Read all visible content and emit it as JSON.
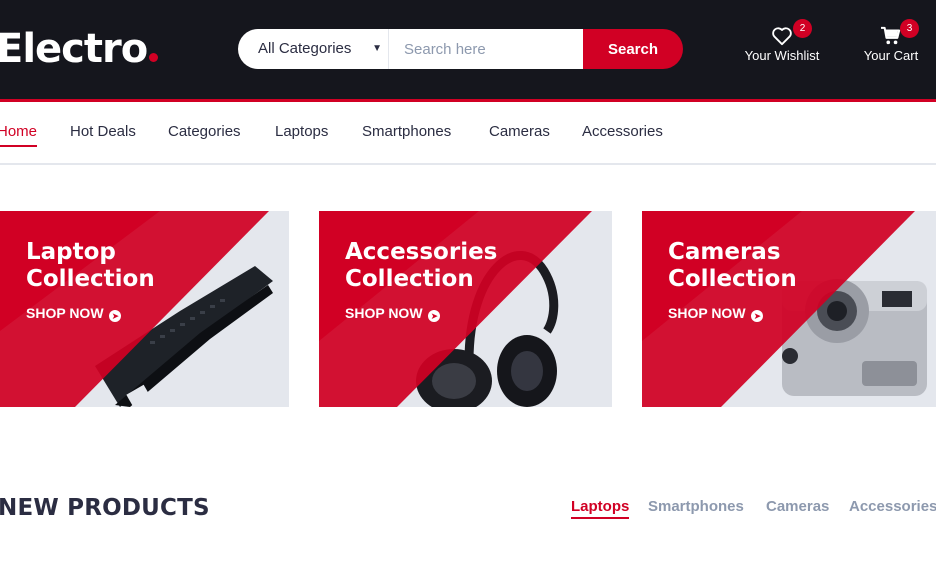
{
  "header": {
    "logo_text": "Electro",
    "search": {
      "category_selected": "All Categories",
      "placeholder": "Search here",
      "value": "",
      "button_label": "Search"
    },
    "wishlist": {
      "label": "Your Wishlist",
      "count": "2",
      "icon": "heart-icon"
    },
    "cart": {
      "label": "Your Cart",
      "count": "3",
      "icon": "cart-icon"
    }
  },
  "nav": {
    "items": [
      {
        "label": "Home",
        "active": true
      },
      {
        "label": "Hot Deals"
      },
      {
        "label": "Categories"
      },
      {
        "label": "Laptops"
      },
      {
        "label": "Smartphones"
      },
      {
        "label": "Cameras"
      },
      {
        "label": "Accessories"
      }
    ]
  },
  "collections": [
    {
      "title_line1": "Laptop",
      "title_line2": "Collection",
      "cta": "SHOP NOW",
      "image": "laptop"
    },
    {
      "title_line1": "Accessories",
      "title_line2": "Collection",
      "cta": "SHOP NOW",
      "image": "headphones"
    },
    {
      "title_line1": "Cameras",
      "title_line2": "Collection",
      "cta": "SHOP NOW",
      "image": "camera"
    }
  ],
  "new_products": {
    "title": "NEW PRODUCTS",
    "tabs": [
      {
        "label": "Laptops",
        "active": true
      },
      {
        "label": "Smartphones"
      },
      {
        "label": "Cameras"
      },
      {
        "label": "Accessories"
      }
    ]
  },
  "colors": {
    "brand_red": "#d10024",
    "header_dark": "#15161d",
    "text_dark": "#2b2d42",
    "text_muted": "#8d99ae",
    "card_bg": "#e4e7ed"
  }
}
